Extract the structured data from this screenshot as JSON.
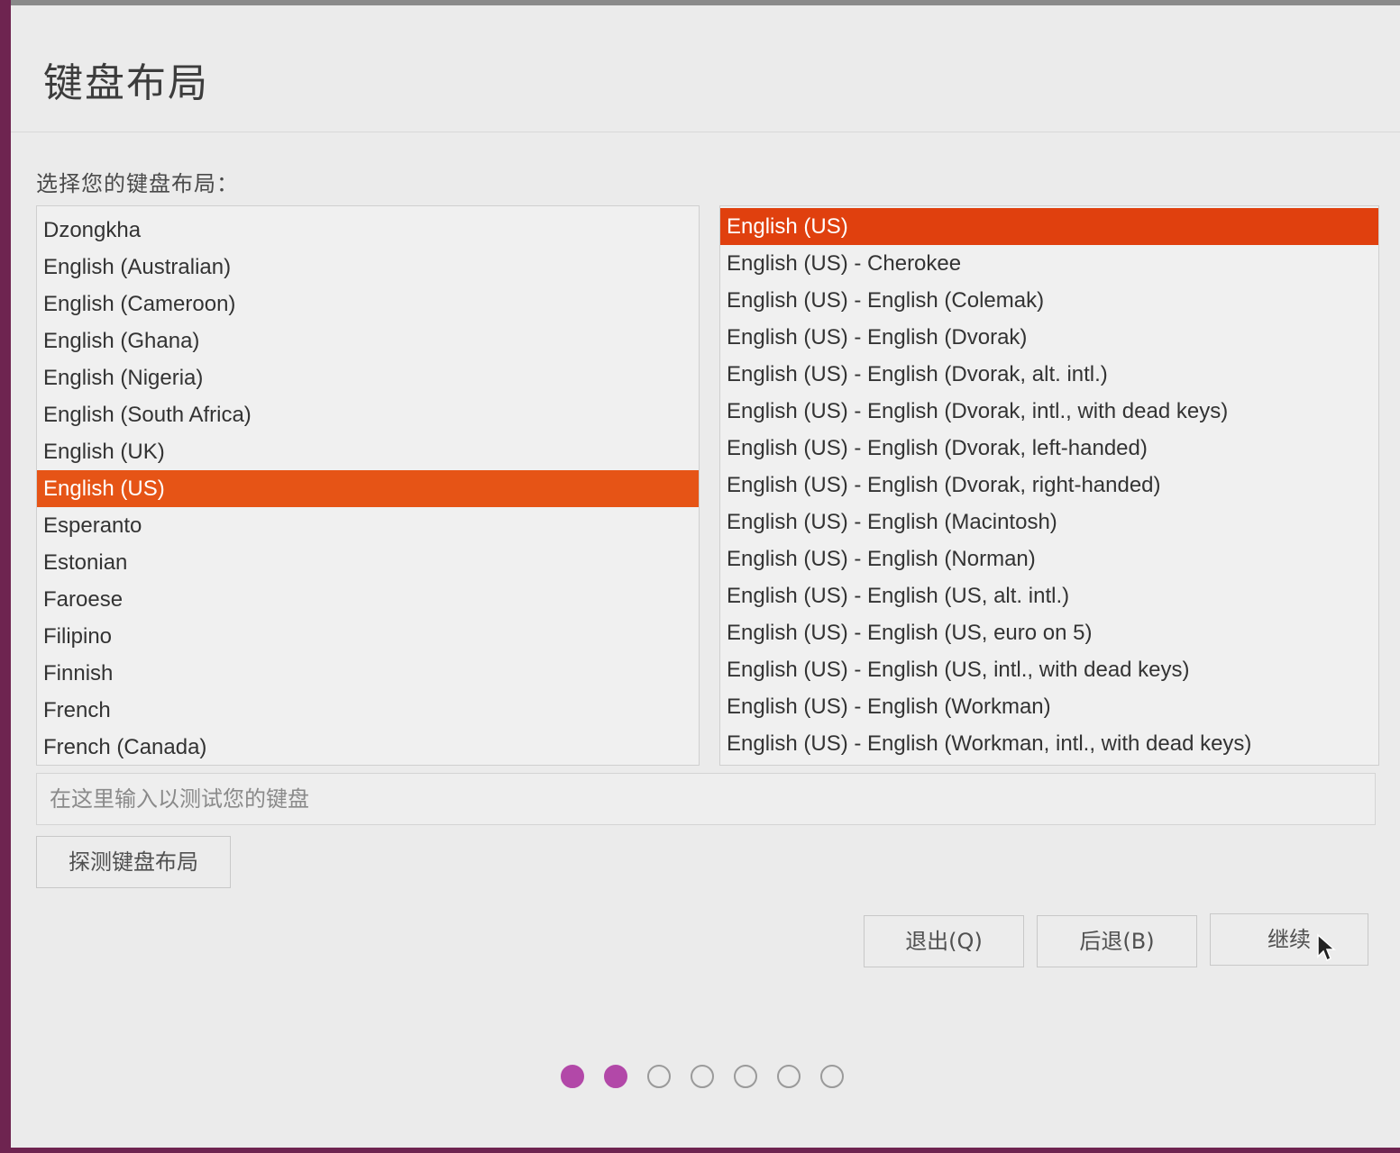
{
  "header": {
    "title": "键盘布局"
  },
  "prompt": "选择您的键盘布局：",
  "layouts": [
    "Dzongkha",
    "English (Australian)",
    "English (Cameroon)",
    "English (Ghana)",
    "English (Nigeria)",
    "English (South Africa)",
    "English (UK)",
    "English (US)",
    "Esperanto",
    "Estonian",
    "Faroese",
    "Filipino",
    "Finnish",
    "French",
    "French (Canada)"
  ],
  "selected_layout": "English (US)",
  "variants": [
    "English (US)",
    "English (US) - Cherokee",
    "English (US) - English (Colemak)",
    "English (US) - English (Dvorak)",
    "English (US) - English (Dvorak, alt. intl.)",
    "English (US) - English (Dvorak, intl., with dead keys)",
    "English (US) - English (Dvorak, left-handed)",
    "English (US) - English (Dvorak, right-handed)",
    "English (US) - English (Macintosh)",
    "English (US) - English (Norman)",
    "English (US) - English (US, alt. intl.)",
    "English (US) - English (US, euro on 5)",
    "English (US) - English (US, intl., with dead keys)",
    "English (US) - English (Workman)",
    "English (US) - English (Workman, intl., with dead keys)"
  ],
  "selected_variant": "English (US)",
  "test_input": {
    "placeholder": "在这里输入以测试您的键盘",
    "value": ""
  },
  "buttons": {
    "detect": "探测键盘布局",
    "quit": "退出(Q)",
    "back": "后退(B)",
    "continue": "继续"
  },
  "progress": {
    "total_steps": 7,
    "completed_steps": 2
  },
  "colors": {
    "selection": "#e65416",
    "active_dot": "#b248a8",
    "background": "#ebebeb"
  }
}
